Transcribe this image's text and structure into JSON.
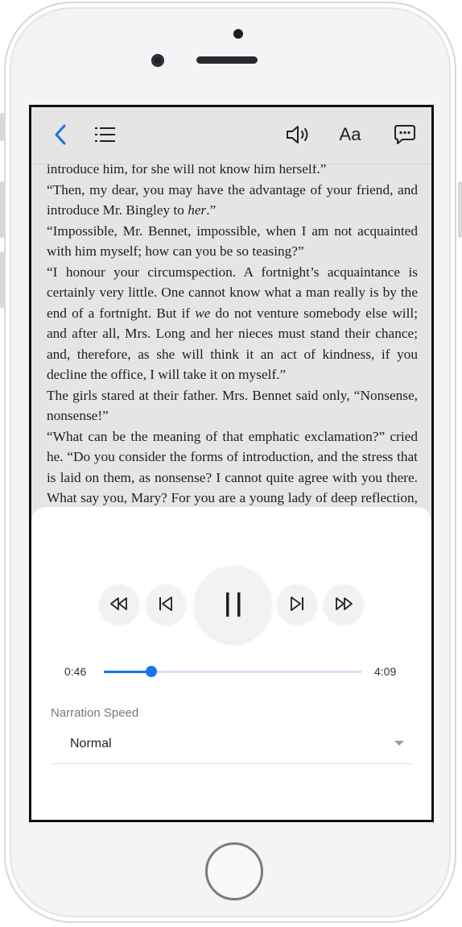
{
  "toolbar": {
    "back_icon": "chevron-left-icon",
    "toc_icon": "list-icon",
    "audio_icon": "speaker-icon",
    "font_label": "Aa",
    "comment_icon": "chat-bubble-icon",
    "accent_color": "#1a73e8"
  },
  "reading": {
    "paragraphs": [
      {
        "segments": [
          {
            "text": "introduce him, for she will not know him herself.”"
          }
        ]
      },
      {
        "segments": [
          {
            "text": "“Then, my dear, you may have the advantage of your friend, and introduce Mr. Bingley to "
          },
          {
            "text": "her",
            "italic": true
          },
          {
            "text": ".”"
          }
        ]
      },
      {
        "segments": [
          {
            "text": "“Impossible, Mr. Bennet, impossible, when I am not acquainted with him myself; how can you be so teasing?”"
          }
        ]
      },
      {
        "segments": [
          {
            "text": "“I honour your circumspection. A fortnight’s acquaintance is certainly very little. One cannot know what a man really is by the end of a fortnight. But if "
          },
          {
            "text": "we",
            "italic": true
          },
          {
            "text": " do not venture somebody else will; and after all, Mrs. Long and her nieces must stand their chance; and, therefore, as she will think it an act of kindness, if you decline the office, I will take it on myself.”"
          }
        ]
      },
      {
        "segments": [
          {
            "text": "The girls stared at their father. Mrs. Bennet said only, “Nonsense, nonsense!”"
          }
        ]
      },
      {
        "segments": [
          {
            "text": "“What can be the meaning of that emphatic exclamation?” cried he. “Do you consider the forms of introduction, and the stress that is laid on them, as nonsense? I cannot quite agree with you there. What say you, Mary? For you are a young lady of deep reflection, I know, and read great books and make extracts.”"
          }
        ]
      }
    ]
  },
  "player": {
    "rewind_icon": "rewind-icon",
    "previous_icon": "skip-previous-icon",
    "pause_icon": "pause-icon",
    "next_icon": "skip-next-icon",
    "fast_forward_icon": "fast-forward-icon",
    "current_time": "0:46",
    "total_time": "4:09",
    "progress_fraction": 0.185,
    "speed_label": "Narration Speed",
    "speed_value": "Normal"
  }
}
